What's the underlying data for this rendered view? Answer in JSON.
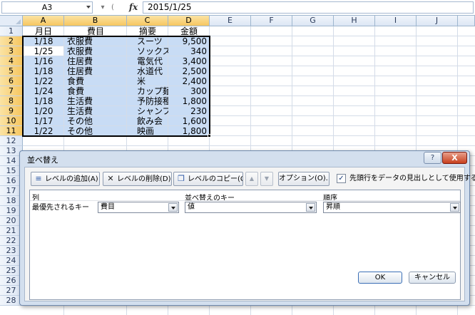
{
  "formula_bar": {
    "name_box": "A3",
    "fx": "fx",
    "formula": "2015/1/25"
  },
  "sheet": {
    "columns": [
      "A",
      "B",
      "C",
      "D",
      "E",
      "F",
      "G",
      "H",
      "I",
      "J"
    ],
    "rows": [
      "1",
      "2",
      "3",
      "4",
      "5",
      "6",
      "7",
      "8",
      "9",
      "10",
      "11",
      "12",
      "13",
      "14",
      "15",
      "16",
      "17",
      "18",
      "19",
      "20",
      "21",
      "22",
      "23",
      "24",
      "25",
      "26",
      "27",
      "28"
    ],
    "header": [
      "月日",
      "費目",
      "摘要",
      "金額"
    ],
    "data": [
      [
        "1/18",
        "衣服費",
        "スーツ",
        "9,500"
      ],
      [
        "1/25",
        "衣服費",
        "ソックス",
        "340"
      ],
      [
        "1/16",
        "住居費",
        "電気代",
        "3,400"
      ],
      [
        "1/18",
        "住居費",
        "水道代",
        "2,500"
      ],
      [
        "1/22",
        "食費",
        "米",
        "2,400"
      ],
      [
        "1/24",
        "食費",
        "カップ麺",
        "300"
      ],
      [
        "1/18",
        "生活費",
        "予防接種",
        "1,800"
      ],
      [
        "1/20",
        "生活費",
        "シャンプー",
        "230"
      ],
      [
        "1/17",
        "その他",
        "飲み会",
        "1,600"
      ],
      [
        "1/22",
        "その他",
        "映画",
        "1,800"
      ]
    ]
  },
  "dialog": {
    "title": "並べ替え",
    "help": "?",
    "close": "X",
    "toolbar": {
      "add_level": "レベルの追加(A)",
      "delete_level": "レベルの削除(D)",
      "copy_level": "レベルのコピー(C)",
      "options": "オプション(O)...",
      "header_checkbox_label": "先頭行をデータの見出しとして使用する(H)",
      "header_checkbox_checked": true
    },
    "columns": {
      "column": "列",
      "sort_on": "並べ替えのキー",
      "order": "順序"
    },
    "level": {
      "label": "最優先されるキー",
      "column": "費目",
      "sort_on": "値",
      "order": "昇順"
    },
    "ok": "OK",
    "cancel": "キャンセル"
  }
}
